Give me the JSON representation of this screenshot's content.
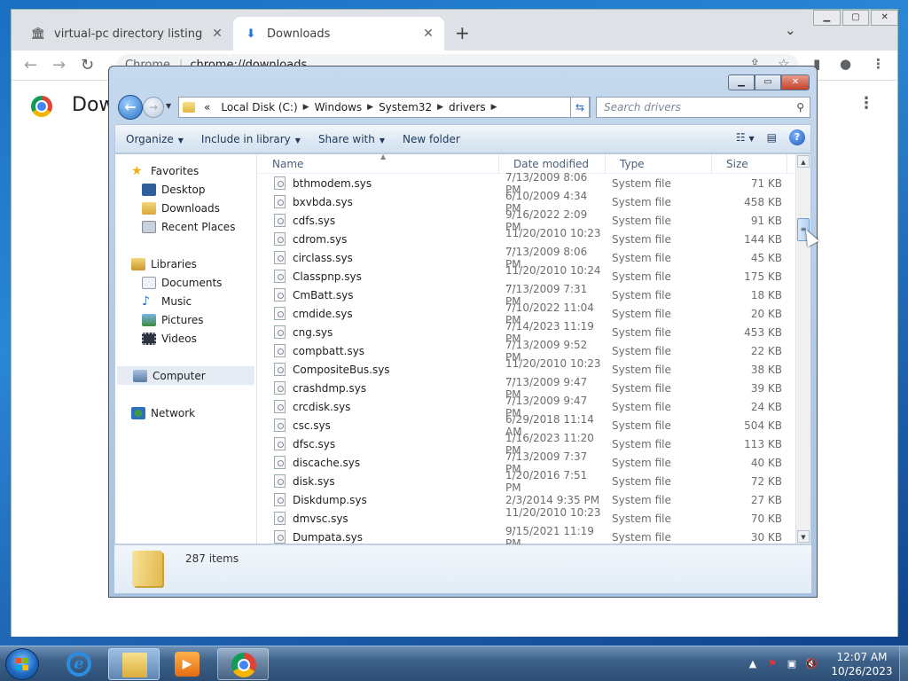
{
  "browser": {
    "tabs": [
      {
        "title": "virtual-pc directory listing",
        "icon": "building-icon"
      },
      {
        "title": "Downloads",
        "icon": "download-icon"
      }
    ],
    "omnibox": {
      "chip": "Chrome",
      "url": "chrome://downloads"
    },
    "page": {
      "title": "Downloads"
    }
  },
  "explorer": {
    "breadcrumb": [
      "Local Disk (C:)",
      "Windows",
      "System32",
      "drivers"
    ],
    "overflow": "«",
    "search_placeholder": "Search drivers",
    "commands": [
      "Organize",
      "Include in library",
      "Share with",
      "New folder"
    ],
    "nav": {
      "favorites": {
        "label": "Favorites",
        "items": [
          "Desktop",
          "Downloads",
          "Recent Places"
        ]
      },
      "libraries": {
        "label": "Libraries",
        "items": [
          "Documents",
          "Music",
          "Pictures",
          "Videos"
        ]
      },
      "computer": "Computer",
      "network": "Network"
    },
    "columns": [
      "Name",
      "Date modified",
      "Type",
      "Size"
    ],
    "files": [
      [
        "bthmodem.sys",
        "7/13/2009 8:06 PM",
        "System file",
        "71 KB"
      ],
      [
        "bxvbda.sys",
        "6/10/2009 4:34 PM",
        "System file",
        "458 KB"
      ],
      [
        "cdfs.sys",
        "9/16/2022 2:09 PM",
        "System file",
        "91 KB"
      ],
      [
        "cdrom.sys",
        "11/20/2010 10:23 ...",
        "System file",
        "144 KB"
      ],
      [
        "circlass.sys",
        "7/13/2009 8:06 PM",
        "System file",
        "45 KB"
      ],
      [
        "Classpnp.sys",
        "11/20/2010 10:24 ...",
        "System file",
        "175 KB"
      ],
      [
        "CmBatt.sys",
        "7/13/2009 7:31 PM",
        "System file",
        "18 KB"
      ],
      [
        "cmdide.sys",
        "7/10/2022 11:04 PM",
        "System file",
        "20 KB"
      ],
      [
        "cng.sys",
        "7/14/2023 11:19 PM",
        "System file",
        "453 KB"
      ],
      [
        "compbatt.sys",
        "7/13/2009 9:52 PM",
        "System file",
        "22 KB"
      ],
      [
        "CompositeBus.sys",
        "11/20/2010 10:23 ...",
        "System file",
        "38 KB"
      ],
      [
        "crashdmp.sys",
        "7/13/2009 9:47 PM",
        "System file",
        "39 KB"
      ],
      [
        "crcdisk.sys",
        "7/13/2009 9:47 PM",
        "System file",
        "24 KB"
      ],
      [
        "csc.sys",
        "6/29/2018 11:14 AM",
        "System file",
        "504 KB"
      ],
      [
        "dfsc.sys",
        "1/16/2023 11:20 PM",
        "System file",
        "113 KB"
      ],
      [
        "discache.sys",
        "7/13/2009 7:37 PM",
        "System file",
        "40 KB"
      ],
      [
        "disk.sys",
        "1/20/2016 7:51 PM",
        "System file",
        "72 KB"
      ],
      [
        "Diskdump.sys",
        "2/3/2014 9:35 PM",
        "System file",
        "27 KB"
      ],
      [
        "dmvsc.sys",
        "11/20/2010 10:23 ...",
        "System file",
        "70 KB"
      ],
      [
        "Dumpata.sys",
        "9/15/2021 11:19 PM",
        "System file",
        "30 KB"
      ]
    ],
    "item_count": "287 items"
  },
  "taskbar": {
    "time": "12:07 AM",
    "date": "10/26/2023",
    "apps": [
      "internet-explorer-icon",
      "windows-explorer-icon",
      "media-player-icon",
      "chrome-icon"
    ]
  },
  "colors": {
    "accent": "#2b86d6",
    "taskbar": "#3d6189",
    "close": "#c4412b"
  }
}
